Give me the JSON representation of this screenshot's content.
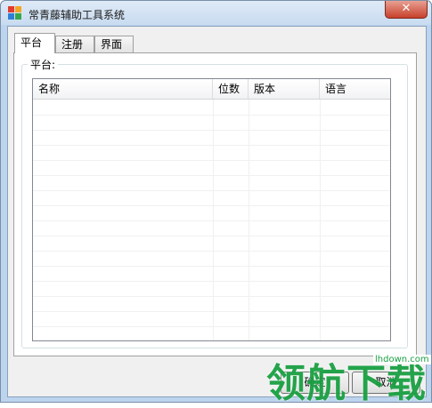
{
  "window": {
    "title": "常青藤辅助工具系统",
    "close_label": "✕"
  },
  "tabs": [
    {
      "label": "平台",
      "active": true
    },
    {
      "label": "注册",
      "active": false
    },
    {
      "label": "界面",
      "active": false
    }
  ],
  "platform_group": {
    "legend": "平台:",
    "columns": [
      "名称",
      "位数",
      "版本",
      "语言"
    ]
  },
  "buttons": {
    "ok": "确定",
    "cancel": "取消"
  },
  "watermark": {
    "text": "领航下载",
    "url": "lhdown.com"
  },
  "colors": {
    "accent": "#1aa043",
    "close_button": "#c7402b",
    "title_bar": "#c8dbf0"
  }
}
